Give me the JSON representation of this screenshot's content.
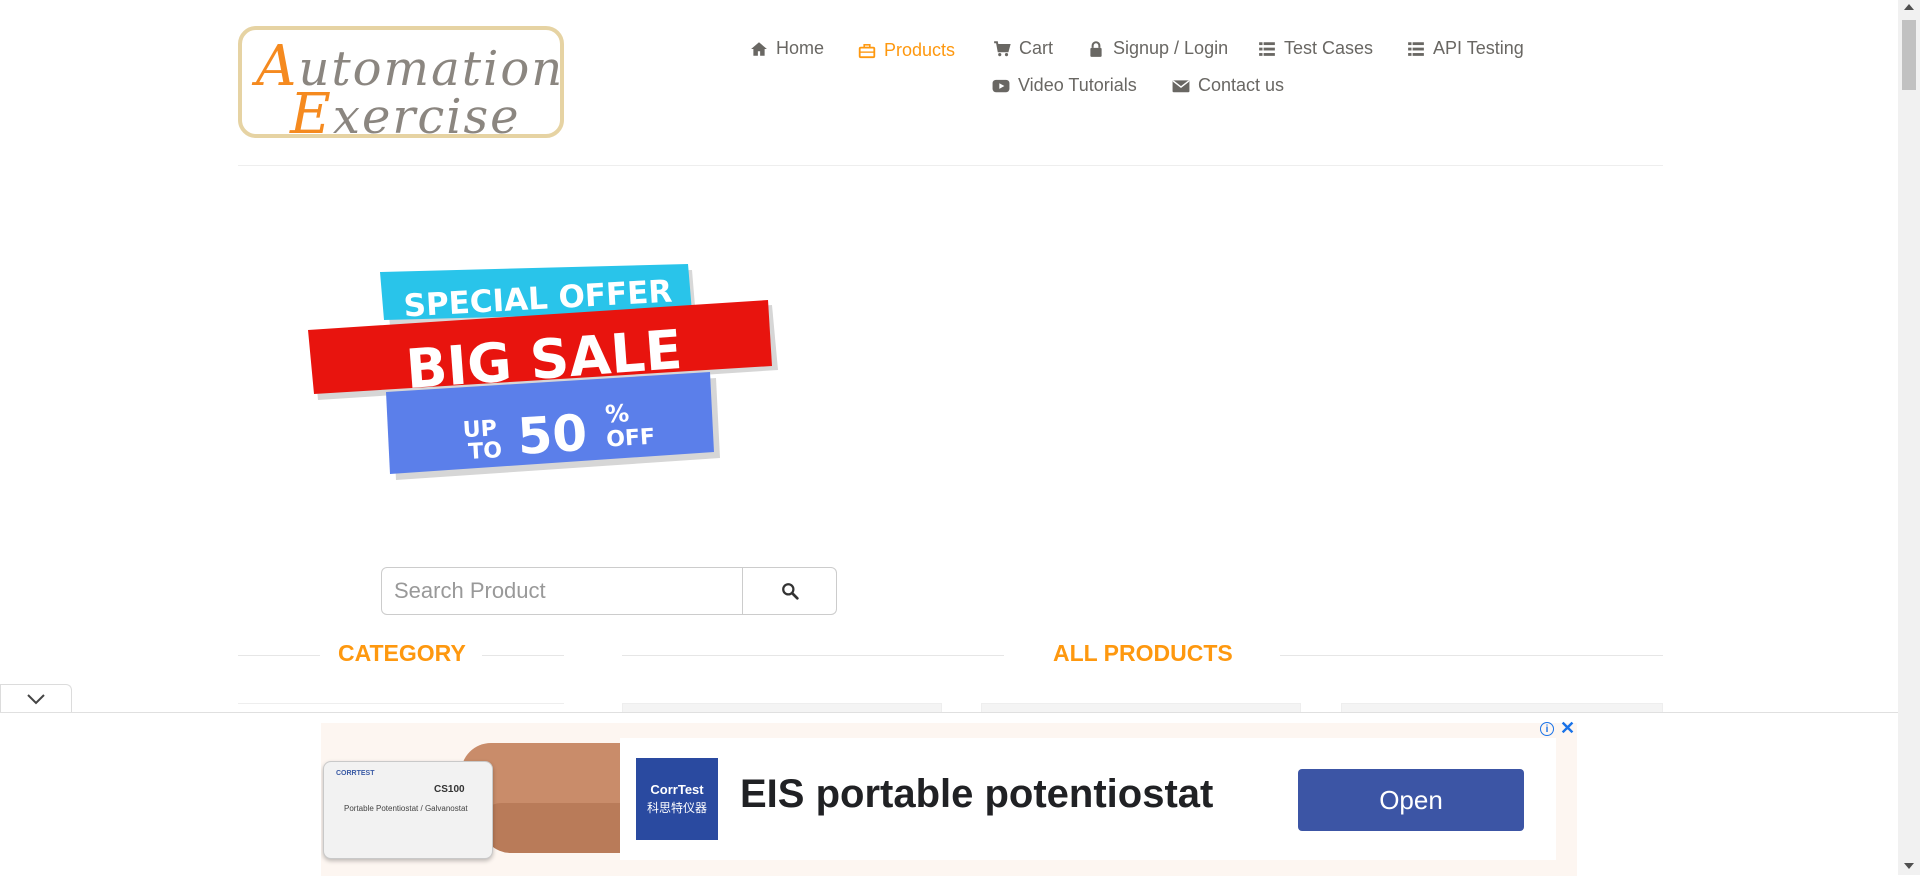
{
  "logo": {
    "line1_cap": "A",
    "line1_rest": "utomation",
    "line2_cap": "E",
    "line2_rest": "xercise"
  },
  "nav": {
    "items": [
      {
        "label": "Home",
        "icon": "home-icon"
      },
      {
        "label": "Products",
        "icon": "briefcase-icon",
        "active": true
      },
      {
        "label": "Cart",
        "icon": "cart-icon"
      },
      {
        "label": "Signup / Login",
        "icon": "lock-icon"
      },
      {
        "label": "Test Cases",
        "icon": "list-icon"
      },
      {
        "label": "API Testing",
        "icon": "list-icon"
      },
      {
        "label": "Video Tutorials",
        "icon": "youtube-icon"
      },
      {
        "label": "Contact us",
        "icon": "envelope-icon"
      }
    ],
    "active_color": "#fe980f"
  },
  "banner": {
    "line1": "SPECIAL OFFER",
    "line2": "BIG SALE",
    "up": "UP",
    "to": "TO",
    "percent": "50",
    "pct_sign": "%",
    "off": "OFF"
  },
  "search": {
    "placeholder": "Search Product",
    "value": "",
    "button_icon": "search-icon"
  },
  "sections": {
    "category": "CATEGORY",
    "all_products": "ALL PRODUCTS"
  },
  "ad": {
    "brand": "CorrTest",
    "brand_cn": "科思特仪器",
    "headline": "EIS portable potentiostat",
    "cta": "Open",
    "device_model": "CS100",
    "device_name": "Portable Potentiostat / Galvanostat",
    "device_brand": "CORRTEST",
    "cta_color": "#3c55a5"
  }
}
